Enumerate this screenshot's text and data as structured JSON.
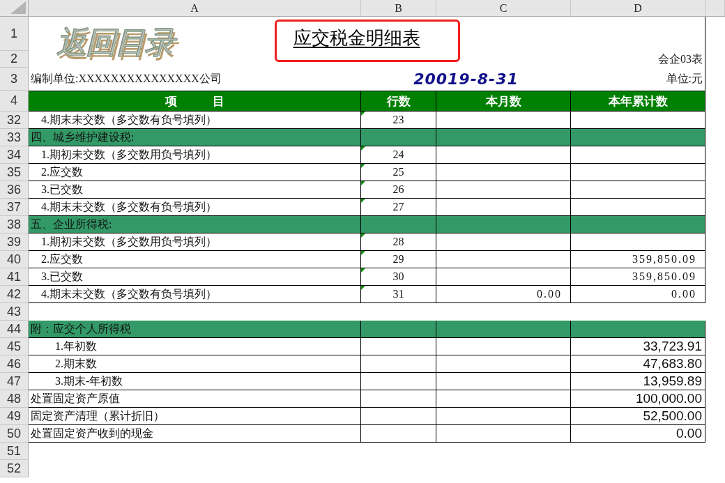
{
  "columns": [
    "A",
    "B",
    "C",
    "D"
  ],
  "logo": "返回目录",
  "title": "应交税金明细表",
  "form_code": "会企03表",
  "company": "编制单位:XXXXXXXXXXXXXXX公司",
  "date": "20019-8-31",
  "unit": "单位:元",
  "top_rows": [
    "1",
    "2",
    "3"
  ],
  "header": {
    "row": "4",
    "cells": [
      "项　　　目",
      "行数",
      "本月数",
      "本年累计数"
    ]
  },
  "rows": [
    {
      "row": "32",
      "kind": "item",
      "item": "4.期末未交数（多交数有负号填列）",
      "line": "23",
      "flagged": true
    },
    {
      "row": "33",
      "kind": "section",
      "item": "四、城乡维护建设税:",
      "flagged": false
    },
    {
      "row": "34",
      "kind": "item",
      "item": "1.期初未交数（多交数用负号填列）",
      "line": "24",
      "flagged": true
    },
    {
      "row": "35",
      "kind": "item",
      "item": "2.应交数",
      "line": "25",
      "flagged": true
    },
    {
      "row": "36",
      "kind": "item",
      "item": "3.已交数",
      "line": "26",
      "flagged": true
    },
    {
      "row": "37",
      "kind": "item",
      "item": "4.期末未交数（多交数有负号填列）",
      "line": "27",
      "flagged": true
    },
    {
      "row": "38",
      "kind": "section",
      "item": "五、企业所得税:",
      "flagged": false
    },
    {
      "row": "39",
      "kind": "item",
      "item": "1.期初未交数（多交数用负号填列）",
      "line": "28",
      "flagged": true
    },
    {
      "row": "40",
      "kind": "item",
      "item": "2.应交数",
      "line": "29",
      "year": "359,850.09",
      "flagged": true
    },
    {
      "row": "41",
      "kind": "item",
      "item": "3.已交数",
      "line": "30",
      "year": "359,850.09",
      "flagged": true
    },
    {
      "row": "42",
      "kind": "item",
      "item": "4.期末未交数（多交数有负号填列）",
      "line": "31",
      "month": "0.00",
      "year": "0.00",
      "flagged": true
    },
    {
      "row": "43",
      "kind": "empty"
    },
    {
      "row": "44",
      "kind": "section",
      "item": "附：应交个人所得税",
      "flagged": false
    },
    {
      "row": "45",
      "kind": "subitem",
      "item": "1.年初数",
      "year": "33,723.91",
      "flagged": false
    },
    {
      "row": "46",
      "kind": "subitem",
      "item": "2.期末数",
      "year": "47,683.80",
      "flagged": false
    },
    {
      "row": "47",
      "kind": "subitem",
      "item": "3.期末-年初数",
      "year": "13,959.89",
      "flagged": false
    },
    {
      "row": "48",
      "kind": "plain",
      "item": "处置固定资产原值",
      "year": "100,000.00",
      "flagged": false
    },
    {
      "row": "49",
      "kind": "plain",
      "item": "固定资产清理（累计折旧）",
      "year": "52,500.00",
      "flagged": false
    },
    {
      "row": "50",
      "kind": "plain",
      "item": "处置固定资产收到的现金",
      "year": "0.00",
      "flagged": false
    },
    {
      "row": "51",
      "kind": "empty"
    },
    {
      "row": "52",
      "kind": "empty"
    }
  ]
}
